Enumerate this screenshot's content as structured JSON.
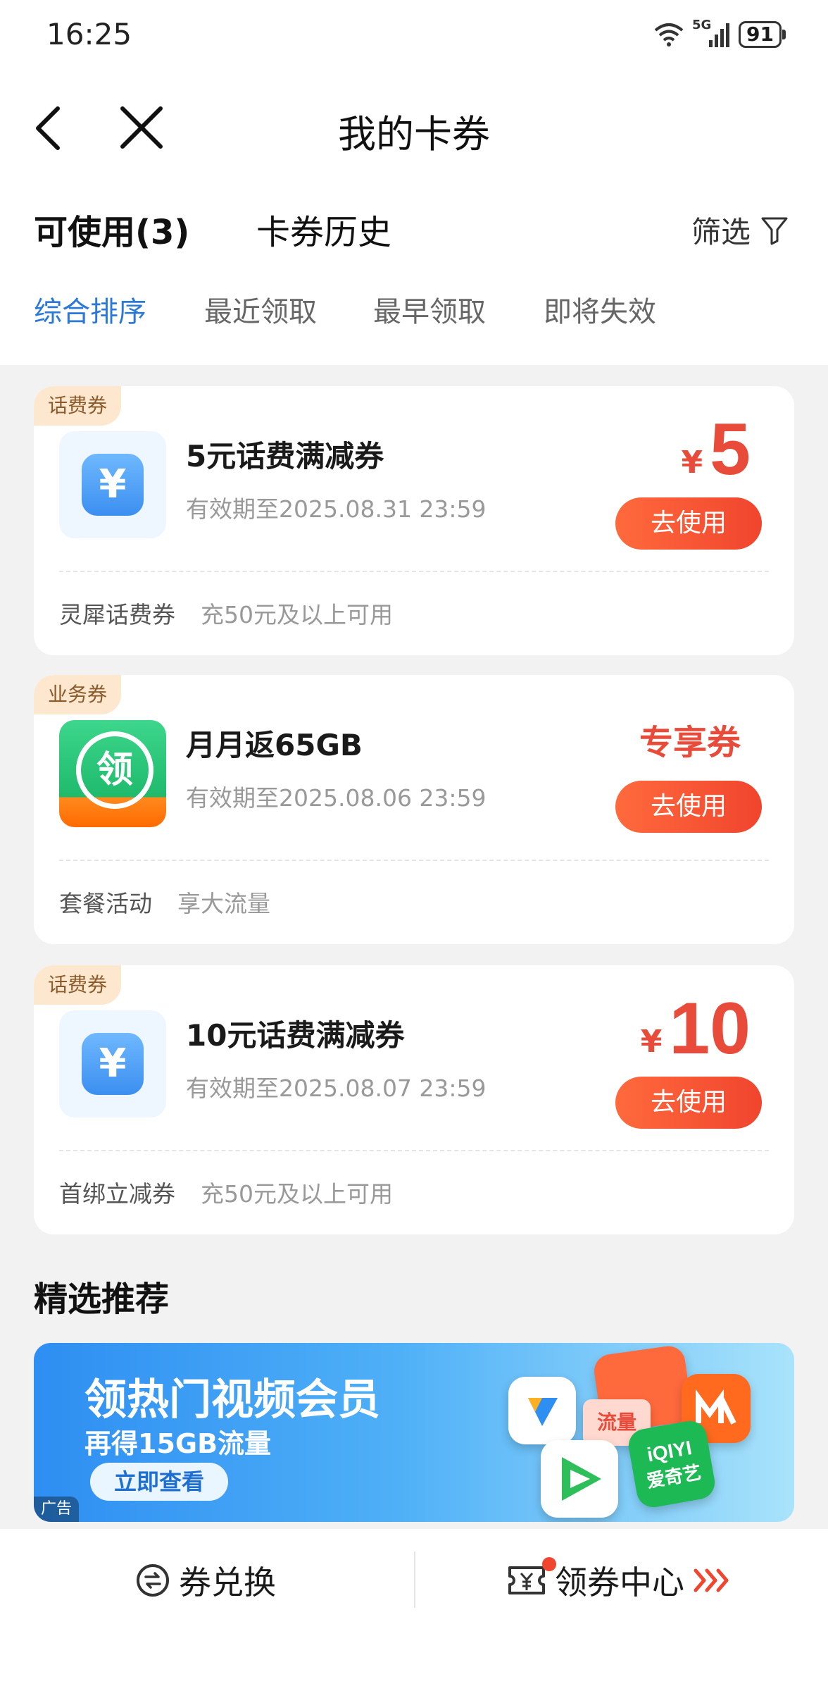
{
  "status_bar": {
    "time": "16:25",
    "network": "5G",
    "battery": "91"
  },
  "header": {
    "title": "我的卡券"
  },
  "tabs": [
    {
      "label": "可使用(3)",
      "active": true
    },
    {
      "label": "卡券历史",
      "active": false
    }
  ],
  "filter": {
    "label": "筛选"
  },
  "sort_options": [
    {
      "label": "综合排序",
      "active": true
    },
    {
      "label": "最近领取",
      "active": false
    },
    {
      "label": "最早领取",
      "active": false
    },
    {
      "label": "即将失效",
      "active": false
    }
  ],
  "coupons": [
    {
      "tag": "话费券",
      "icon": "yen-icon",
      "title": "5元话费满减券",
      "expiry": "有效期至2025.08.31 23:59",
      "currency": "¥",
      "amount": "5",
      "button": "去使用",
      "source": "灵犀话费券",
      "condition": "充50元及以上可用"
    },
    {
      "tag": "业务券",
      "icon": "ling-icon",
      "title": "月月返65GB",
      "expiry": "有效期至2025.08.06 23:59",
      "badge": "专享券",
      "button": "去使用",
      "source": "套餐活动",
      "condition": "享大流量"
    },
    {
      "tag": "话费券",
      "icon": "yen-icon",
      "title": "10元话费满减券",
      "expiry": "有效期至2025.08.07 23:59",
      "currency": "¥",
      "amount": "10",
      "button": "去使用",
      "source": "首绑立减券",
      "condition": "充50元及以上可用"
    }
  ],
  "recommend": {
    "title": "精选推荐",
    "banner": {
      "headline": "领热门视频会员",
      "subline": "再得15GB流量",
      "cta": "立即查看",
      "ad_label": "广告",
      "logo_text": "爱奇艺",
      "badge_text": "流量"
    }
  },
  "bottom_nav": {
    "exchange_label": "券兑换",
    "center_label": "领券中心"
  },
  "colors": {
    "accent": "#e84b3a",
    "active_sort": "#2b78d6",
    "button": "#f0452e"
  }
}
